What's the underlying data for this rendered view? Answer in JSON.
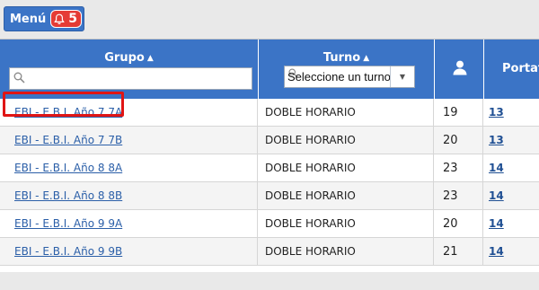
{
  "menu": {
    "label": "Menú",
    "notification_count": "5",
    "icon": "bell-icon"
  },
  "table": {
    "headers": {
      "grupo": "Grupo",
      "turno": "Turno",
      "alumnos_icon": "user-icon",
      "portafolio": "Portafo"
    },
    "grupo_filter": {
      "value": "",
      "placeholder": ""
    },
    "turno_filter": {
      "selected": "Seleccione un turno"
    },
    "rows": [
      {
        "grupo": "EBI - E.B.I. Año 7 7A",
        "turno": "DOBLE HORARIO",
        "count": "19",
        "portafolio": "13"
      },
      {
        "grupo": "EBI - E.B.I. Año 7 7B",
        "turno": "DOBLE HORARIO",
        "count": "20",
        "portafolio": "13"
      },
      {
        "grupo": "EBI - E.B.I. Año 8 8A",
        "turno": "DOBLE HORARIO",
        "count": "23",
        "portafolio": "14"
      },
      {
        "grupo": "EBI - E.B.I. Año 8 8B",
        "turno": "DOBLE HORARIO",
        "count": "23",
        "portafolio": "14"
      },
      {
        "grupo": "EBI - E.B.I. Año 9 9A",
        "turno": "DOBLE HORARIO",
        "count": "20",
        "portafolio": "14"
      },
      {
        "grupo": "EBI - E.B.I. Año 9 9B",
        "turno": "DOBLE HORARIO",
        "count": "21",
        "portafolio": "14"
      }
    ]
  },
  "colors": {
    "header_blue": "#3b74c6",
    "badge_red": "#e53b35",
    "highlight_red": "#e01515",
    "link_blue": "#2b5fa8"
  }
}
